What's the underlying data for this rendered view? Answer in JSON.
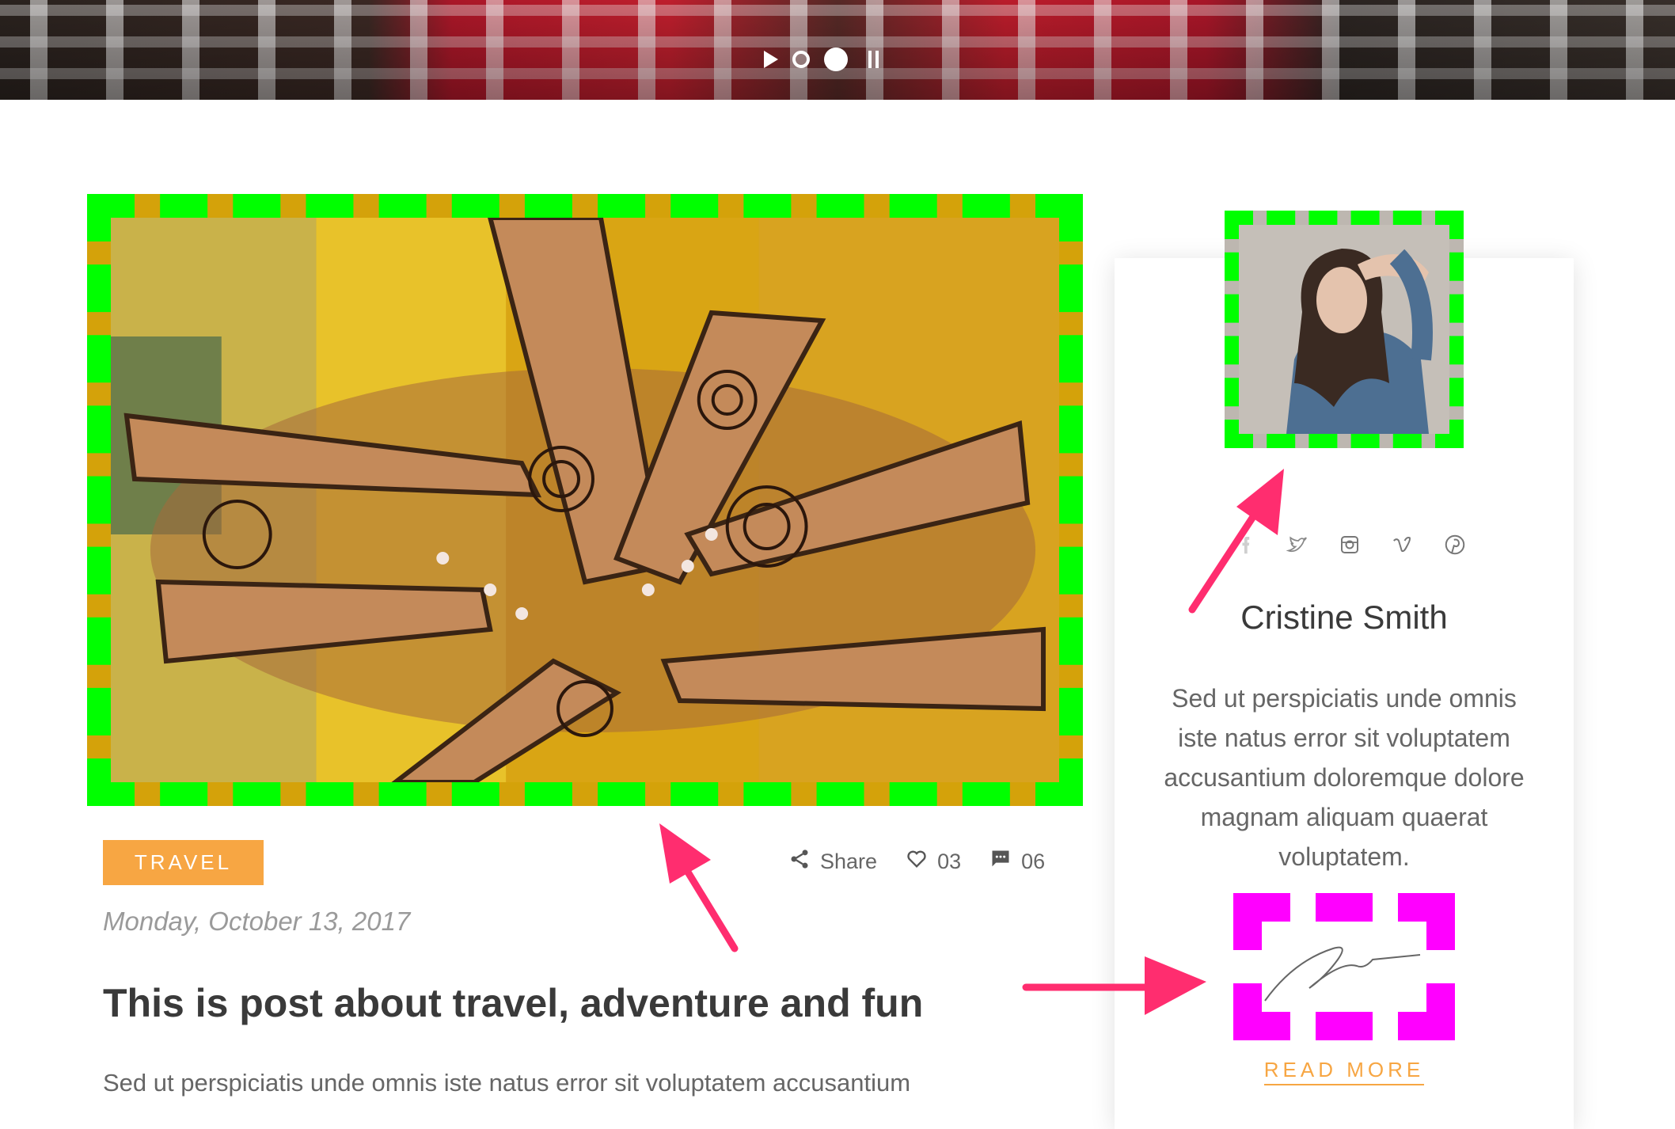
{
  "hero": {
    "controls": [
      "play-icon",
      "dot-icon",
      "dot-icon-active",
      "pause-icon"
    ]
  },
  "post": {
    "image_alt": "henna-hands-photo",
    "category": "TRAVEL",
    "actions": {
      "share_label": "Share",
      "likes": "03",
      "comments": "06"
    },
    "date": "Monday, October 13, 2017",
    "title": "This is post about travel, adventure and fun",
    "excerpt": "Sed ut perspiciatis unde omnis iste natus error sit voluptatem accusantium"
  },
  "author": {
    "avatar_alt": "author-portrait",
    "social": [
      "facebook-icon",
      "twitter-icon",
      "instagram-icon",
      "vimeo-icon",
      "pinterest-icon"
    ],
    "name": "Cristine Smith",
    "bio": "Sed ut perspiciatis unde omnis iste natus error sit voluptatem accusantium doloremque dolore magnam aliquam quaerat voluptatem.",
    "read_more": "READ MORE"
  },
  "colors": {
    "accent": "#f7a643",
    "highlight_green": "#00ff00",
    "highlight_magenta": "#ff00ff",
    "arrow": "#ff2d6f"
  }
}
